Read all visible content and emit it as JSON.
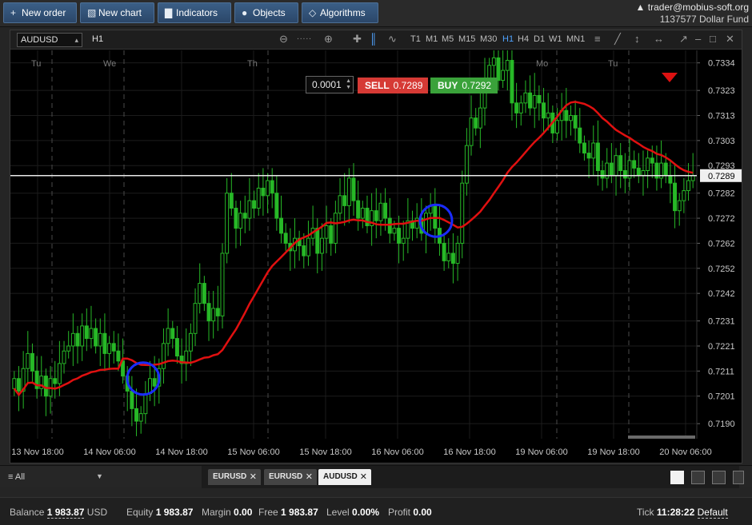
{
  "toolbar": {
    "new_order": "New order",
    "new_chart": "New chart",
    "indicators": "Indicators",
    "objects": "Objects",
    "algorithms": "Algorithms"
  },
  "account": {
    "user": "trader@mobius-soft.org",
    "number": "1137577",
    "fund": "Dollar Fund"
  },
  "chart": {
    "symbol": "AUDUSD",
    "timeframe": "H1",
    "timeframes": [
      "T1",
      "M1",
      "M5",
      "M15",
      "M30",
      "H1",
      "H4",
      "D1",
      "W1",
      "MN1"
    ],
    "active_timeframe": "H1",
    "lot": "0.0001",
    "sell_label": "SELL",
    "sell_price": "0.7289",
    "buy_label": "BUY",
    "buy_price": "0.7292",
    "day_labels": [
      "Tu",
      "We",
      "Th",
      "Mo",
      "Tu"
    ],
    "colors": {
      "candle": "#27b827",
      "ma": "#e01010",
      "price_line": "#e8e8e8",
      "marker": "#1a2cff",
      "sell": "#d63a35",
      "buy": "#3aa23a"
    }
  },
  "chart_data": {
    "type": "candlestick",
    "symbol": "AUDUSD",
    "timeframe": "H1",
    "y_ticks": [
      0.7334,
      0.7323,
      0.7313,
      0.7303,
      0.7293,
      0.7282,
      0.7272,
      0.7262,
      0.7252,
      0.7242,
      0.7231,
      0.7221,
      0.7211,
      0.7201,
      0.719
    ],
    "ylim": [
      0.7184,
      0.7339
    ],
    "current_price": 0.7289,
    "current_price_label": "0.7289",
    "x_tick_labels": [
      "13 Nov 18:00",
      "14 Nov 06:00",
      "14 Nov 18:00",
      "15 Nov 06:00",
      "15 Nov 18:00",
      "16 Nov 06:00",
      "16 Nov 18:00",
      "19 Nov 06:00",
      "19 Nov 18:00",
      "20 Nov 06:00"
    ],
    "close": [
      0.7208,
      0.7203,
      0.7212,
      0.7218,
      0.7211,
      0.7204,
      0.7209,
      0.7201,
      0.7208,
      0.7206,
      0.7214,
      0.7219,
      0.7221,
      0.7226,
      0.7221,
      0.7229,
      0.7224,
      0.7228,
      0.7221,
      0.7226,
      0.7218,
      0.7222,
      0.7219,
      0.7215,
      0.7209,
      0.7203,
      0.7196,
      0.7191,
      0.7194,
      0.7202,
      0.7208,
      0.7205,
      0.7212,
      0.7222,
      0.7228,
      0.7224,
      0.7217,
      0.7214,
      0.7219,
      0.7226,
      0.7238,
      0.7246,
      0.7238,
      0.7231,
      0.7236,
      0.7233,
      0.7258,
      0.7282,
      0.7276,
      0.7268,
      0.7274,
      0.7272,
      0.7279,
      0.7276,
      0.7284,
      0.7281,
      0.7287,
      0.7282,
      0.7272,
      0.7266,
      0.7262,
      0.7259,
      0.7264,
      0.7261,
      0.7257,
      0.7264,
      0.7268,
      0.7258,
      0.7264,
      0.7269,
      0.7262,
      0.7274,
      0.7281,
      0.7277,
      0.7288,
      0.7279,
      0.7272,
      0.7276,
      0.7269,
      0.7275,
      0.7271,
      0.7278,
      0.7272,
      0.7266,
      0.7268,
      0.7262,
      0.7264,
      0.7271,
      0.7268,
      0.7272,
      0.7266,
      0.7274,
      0.7277,
      0.7268,
      0.7262,
      0.7255,
      0.7258,
      0.7254,
      0.7262,
      0.7286,
      0.7301,
      0.7312,
      0.7308,
      0.7316,
      0.7328,
      0.7333,
      0.7336,
      0.7327,
      0.7331,
      0.7335,
      0.7318,
      0.7314,
      0.7318,
      0.7322,
      0.7316,
      0.7321,
      0.7318,
      0.7312,
      0.7314,
      0.7306,
      0.7311,
      0.7315,
      0.7311,
      0.7313,
      0.7308,
      0.7302,
      0.7298,
      0.7296,
      0.7302,
      0.7291,
      0.7288,
      0.7294,
      0.7289,
      0.7297,
      0.7291,
      0.7288,
      0.7295,
      0.7292,
      0.7289,
      0.7291,
      0.7296,
      0.7294,
      0.7288,
      0.7294,
      0.7289,
      0.7286,
      0.7275,
      0.7279,
      0.7283,
      0.7287,
      0.7289
    ]
  },
  "tabs_bar": {
    "filter": "All",
    "tabs": [
      "EURUSD",
      "EURUSD",
      "AUDUSD"
    ],
    "active_tab": 2
  },
  "status": {
    "balance_label": "Balance",
    "balance_value": "1 983.87",
    "currency": "USD",
    "equity_label": "Equity",
    "equity_value": "1 983.87",
    "margin_label": "Margin",
    "margin_value": "0.00",
    "free_label": "Free",
    "free_value": "1 983.87",
    "level_label": "Level",
    "level_value": "0.00%",
    "profit_label": "Profit",
    "profit_value": "0.00",
    "tick_label": "Tick",
    "tick_time": "11:28:22",
    "tick_mode": "Default"
  }
}
